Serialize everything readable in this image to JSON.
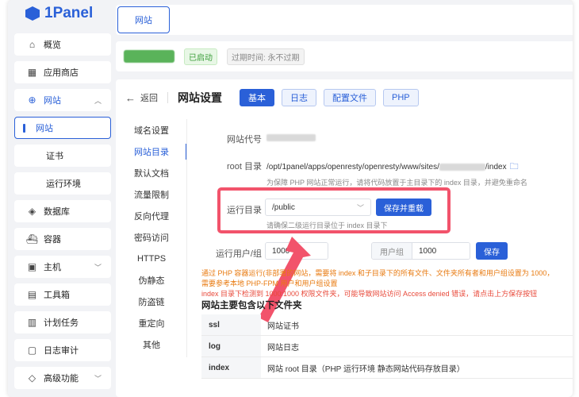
{
  "brand": {
    "name": "1Panel"
  },
  "sidebar": {
    "items": [
      {
        "label": "概览",
        "icon": "home-icon",
        "glyph": "⌂"
      },
      {
        "label": "应用商店",
        "icon": "apps-icon",
        "glyph": "▦"
      },
      {
        "label": "网站",
        "icon": "globe-icon",
        "glyph": "⊕",
        "expanded": true
      },
      {
        "label": "网站",
        "sub": true,
        "active": true
      },
      {
        "label": "证书",
        "sub": true
      },
      {
        "label": "运行环境",
        "sub": true
      },
      {
        "label": "数据库",
        "icon": "database-icon",
        "glyph": "◈"
      },
      {
        "label": "容器",
        "icon": "container-icon",
        "glyph": "⛴"
      },
      {
        "label": "主机",
        "icon": "host-icon",
        "glyph": "▣",
        "chevron": true
      },
      {
        "label": "工具箱",
        "icon": "toolbox-icon",
        "glyph": "▤"
      },
      {
        "label": "计划任务",
        "icon": "schedule-icon",
        "glyph": "▥"
      },
      {
        "label": "日志审计",
        "icon": "log-icon",
        "glyph": "▢"
      },
      {
        "label": "高级功能",
        "icon": "diamond-icon",
        "glyph": "◇",
        "chevron": true
      }
    ]
  },
  "topbar": {
    "tab": "网站"
  },
  "info": {
    "status": "已启动",
    "expire": "过期时间: 永不过期"
  },
  "header": {
    "back": "返回",
    "title": "网站设置",
    "tabs": [
      {
        "label": "基本",
        "active": true
      },
      {
        "label": "日志"
      },
      {
        "label": "配置文件"
      },
      {
        "label": "PHP"
      }
    ]
  },
  "subnav": [
    "域名设置",
    "网站目录",
    "默认文档",
    "流量限制",
    "反向代理",
    "密码访问",
    "HTTPS",
    "伪静态",
    "防盗链",
    "重定向",
    "其他"
  ],
  "subnav_active": 1,
  "form": {
    "site_code_label": "网站代号",
    "root_label": "root 目录",
    "root_prefix": "/opt/1panel/apps/openresty/openresty/www/sites/",
    "root_suffix": "/index",
    "root_hint": "为保障 PHP 网站正常运行，请将代码放置于主目录下的 index 目录，并避免重命名",
    "run_dir_label": "运行目录",
    "run_dir_value": "/public",
    "run_dir_hint": "请确保二级运行目录位于 index 目录下",
    "save_reload": "保存并重载",
    "run_user_label": "运行用户/组",
    "user_value": "1000",
    "group_prefix": "用户组",
    "group_value": "1000",
    "save": "保存"
  },
  "warnings": [
    "通过 PHP 容器运行(非部署的网站，需要将 index 和子目录下的所有文件、文件夹所有者和用户组设置为 1000，",
    "需要参考本地 PHP-FPM 用户和用户组设置",
    "index 目录下检测到 1000:1000 权限文件夹，可能导致网站访问 Access denied 错误，请点击上方保存按钮"
  ],
  "files_title": "网站主要包含以下文件夹",
  "files": [
    {
      "name": "ssl",
      "desc": "网站证书"
    },
    {
      "name": "log",
      "desc": "网站日志"
    },
    {
      "name": "index",
      "desc": "网站 root 目录（PHP 运行环境 静态网站代码存放目录）"
    }
  ],
  "colors": {
    "accent": "#2a60d8",
    "highlight": "#f2536b",
    "warning": "#e87a10",
    "danger": "#e84a3b",
    "success": "#3b9d3b"
  }
}
